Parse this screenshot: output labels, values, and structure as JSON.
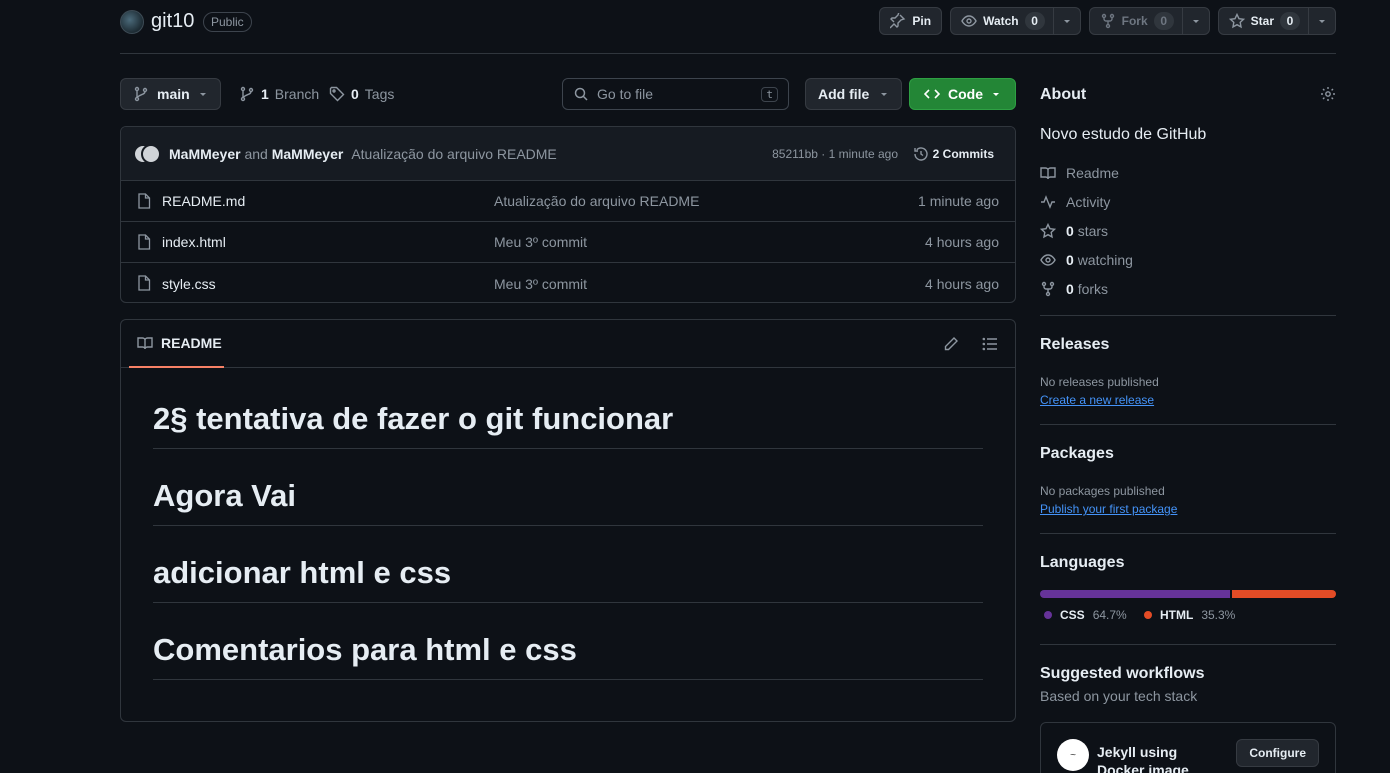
{
  "repo": {
    "name": "git10",
    "visibility": "Public"
  },
  "header_actions": {
    "pin_label": "Pin",
    "watch_label": "Watch",
    "watch_count": "0",
    "fork_label": "Fork",
    "fork_count": "0",
    "star_label": "Star",
    "star_count": "0"
  },
  "toolbar": {
    "branch": "main",
    "branch_count": "1",
    "branch_label": "Branch",
    "tags_count": "0",
    "tags_label": "Tags",
    "goto_placeholder": "Go to file",
    "goto_shortcut": "t",
    "add_file_label": "Add file",
    "code_label": "Code"
  },
  "commit": {
    "author1": "MaMMeyer",
    "and": "and",
    "author2": "MaMMeyer",
    "message": "Atualização do arquivo README",
    "meta": "85211bb · 1 minute ago",
    "count_label": "2 Commits"
  },
  "files": [
    {
      "name": "README.md",
      "message": "Atualização do arquivo README",
      "time": "1 minute ago"
    },
    {
      "name": "index.html",
      "message": "Meu 3º commit",
      "time": "4 hours ago"
    },
    {
      "name": "style.css",
      "message": "Meu 3º commit",
      "time": "4 hours ago"
    }
  ],
  "readme": {
    "tab_label": "README",
    "headings": [
      "2§ tentativa de fazer o git funcionar",
      "Agora Vai",
      "adicionar html e css",
      "Comentarios para html e css"
    ]
  },
  "about": {
    "title": "About",
    "description": "Novo estudo de GitHub",
    "readme_label": "Readme",
    "activity_label": "Activity",
    "stars_count": "0",
    "stars_label": "stars",
    "watching_count": "0",
    "watching_label": "watching",
    "forks_count": "0",
    "forks_label": "forks"
  },
  "releases": {
    "title": "Releases",
    "none": "No releases published",
    "link": "Create a new release"
  },
  "packages": {
    "title": "Packages",
    "none": "No packages published",
    "link": "Publish your first package"
  },
  "languages": {
    "title": "Languages",
    "items": [
      {
        "name": "CSS",
        "percent": "64.7%",
        "value": 64.7,
        "color": "#663399"
      },
      {
        "name": "HTML",
        "percent": "35.3%",
        "value": 35.3,
        "color": "#e34c26"
      }
    ]
  },
  "workflows": {
    "title": "Suggested workflows",
    "subtitle": "Based on your tech stack",
    "card_name": "Jekyll using Docker image",
    "configure_label": "Configure"
  },
  "colors": {
    "background": "#0d1117",
    "accent_green": "#238636",
    "link_blue": "#4493f8",
    "tab_underline": "#f78166"
  }
}
